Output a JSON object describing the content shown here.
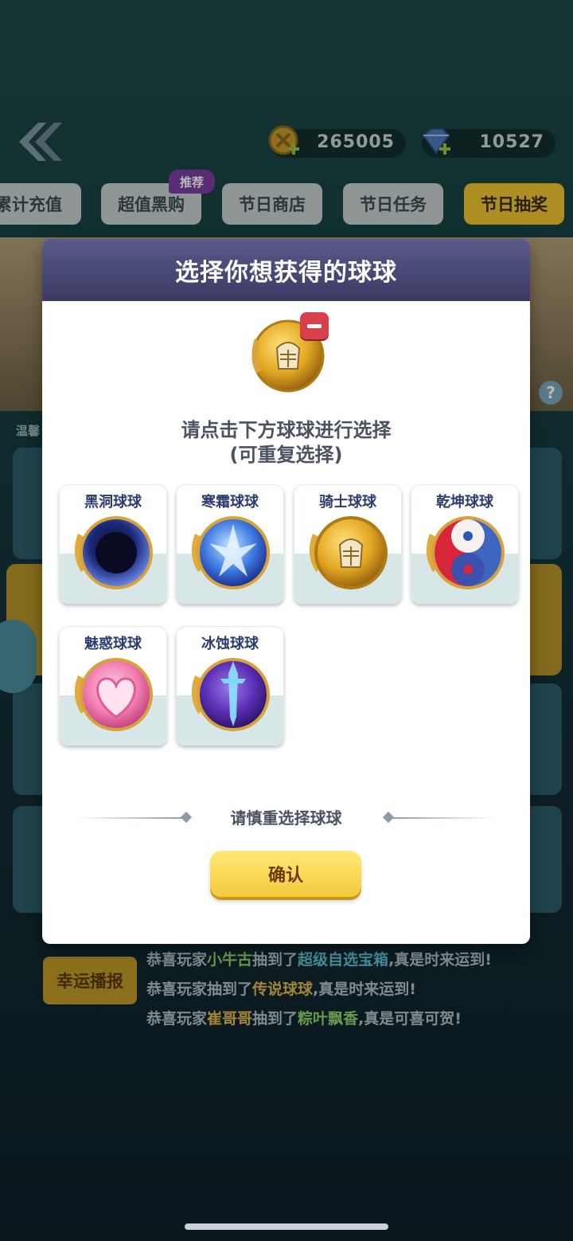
{
  "header": {
    "coins": "265005",
    "gems": "10527"
  },
  "tabs": [
    {
      "label": "累计充值"
    },
    {
      "label": "超值黑购"
    },
    {
      "label": "节日商店"
    },
    {
      "label": "节日任务"
    },
    {
      "label": "节日抽奖"
    }
  ],
  "tab_badge": "推荐",
  "background": {
    "tip_label": "温馨",
    "help_icon": "?",
    "lucky_button": "幸运播报",
    "broadcasts": [
      {
        "pre": "恭喜玩家",
        "player": "小牛古",
        "mid": "抽到了",
        "item": "超级自选宝箱",
        "post": ",真是时来运到!"
      },
      {
        "pre": "恭喜玩家",
        "player": "",
        "mid": "抽到了",
        "item": "传说球球",
        "post": ",真是时来运到!"
      },
      {
        "pre": "恭喜玩家",
        "player": "崔哥哥",
        "mid": "抽到了",
        "item": "粽叶飘香",
        "post": ",真是可喜可贺!"
      }
    ]
  },
  "modal": {
    "title": "选择你想获得的球球",
    "instruction_line1": "请点击下方球球进行选择",
    "instruction_line2": "(可重复选择)",
    "balls": [
      {
        "name": "黑洞球球",
        "icon": "black-hole-ball-icon"
      },
      {
        "name": "寒霜球球",
        "icon": "frost-ball-icon"
      },
      {
        "name": "骑士球球",
        "icon": "knight-ball-icon"
      },
      {
        "name": "乾坤球球",
        "icon": "qiankun-ball-icon"
      },
      {
        "name": "魅惑球球",
        "icon": "charm-ball-icon"
      },
      {
        "name": "冰蚀球球",
        "icon": "ice-erosion-ball-icon"
      }
    ],
    "warning": "请慎重选择球球",
    "confirm_label": "确认"
  }
}
